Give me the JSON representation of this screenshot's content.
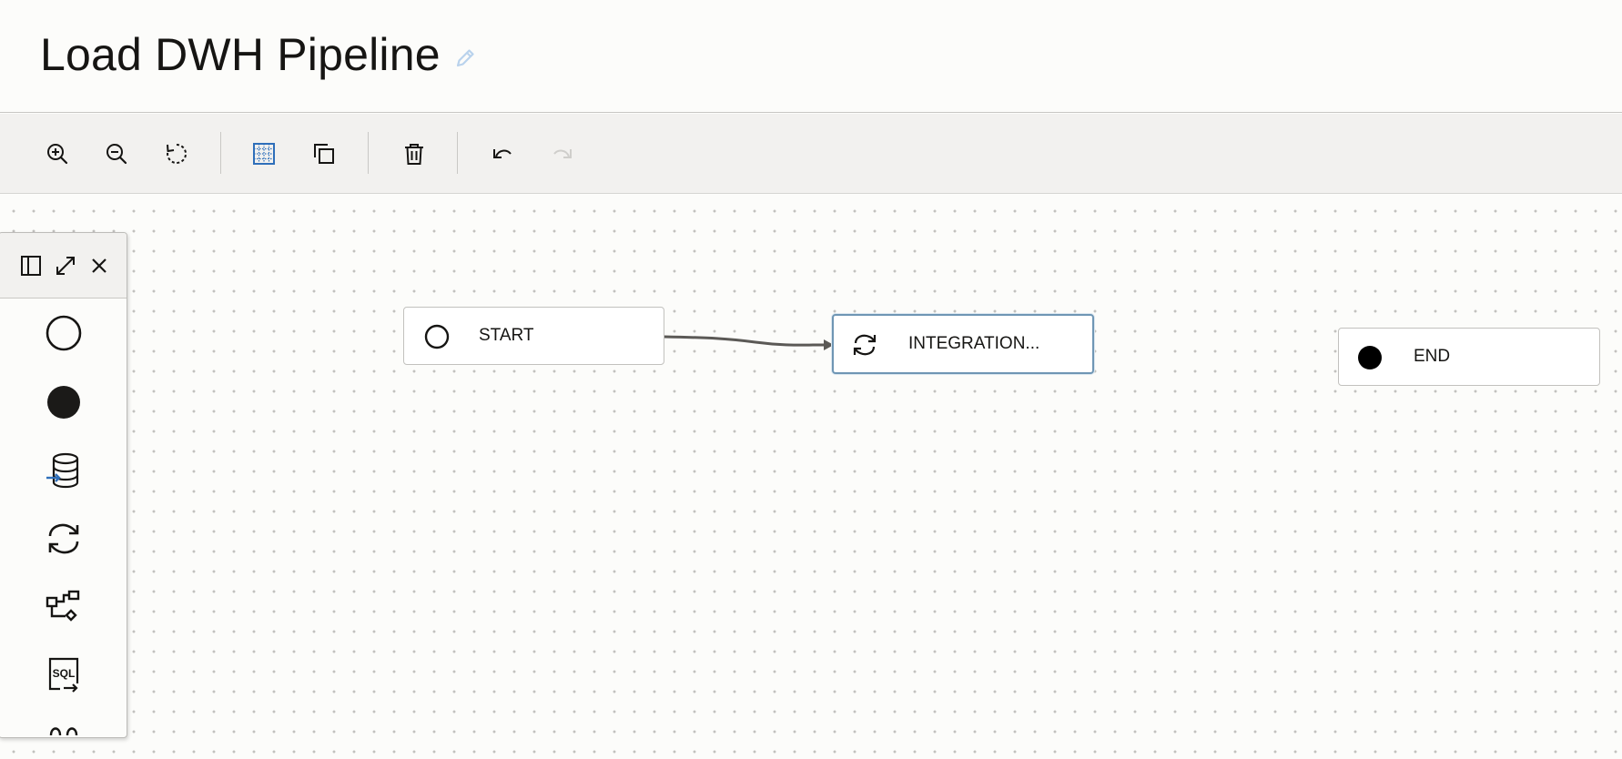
{
  "header": {
    "title": "Load DWH Pipeline"
  },
  "toolbar": {
    "buttons": [
      {
        "icon": "zoom-in-icon"
      },
      {
        "icon": "zoom-out-icon"
      },
      {
        "icon": "reset-icon"
      },
      {
        "icon": "grid-icon",
        "active": true
      },
      {
        "icon": "copy-icon"
      },
      {
        "icon": "delete-icon"
      },
      {
        "icon": "undo-icon"
      },
      {
        "icon": "redo-icon",
        "disabled": true
      }
    ]
  },
  "palette": {
    "header_icons": [
      "panel-toggle-icon",
      "expand-icon",
      "close-icon"
    ],
    "items": [
      {
        "icon": "start-operator-icon"
      },
      {
        "icon": "end-operator-icon"
      },
      {
        "icon": "data-loader-task-icon"
      },
      {
        "icon": "integration-task-icon"
      },
      {
        "icon": "pipeline-task-icon"
      },
      {
        "icon": "sql-task-icon"
      },
      {
        "icon": "more-operator-icon"
      }
    ]
  },
  "nodes": [
    {
      "id": "start",
      "label": "START",
      "icon": "start-circle-icon"
    },
    {
      "id": "integration",
      "label": "INTEGRATION...",
      "icon": "integration-task-icon",
      "selected": true
    },
    {
      "id": "end",
      "label": "END",
      "icon": "end-circle-icon"
    }
  ],
  "edges": [
    {
      "from": "start",
      "to": "integration"
    }
  ],
  "colors": {
    "accent": "#2f6fba",
    "selected_border": "#6f96b4",
    "edge": "#5b5956",
    "toolbar_bg": "#f2f1ef"
  }
}
